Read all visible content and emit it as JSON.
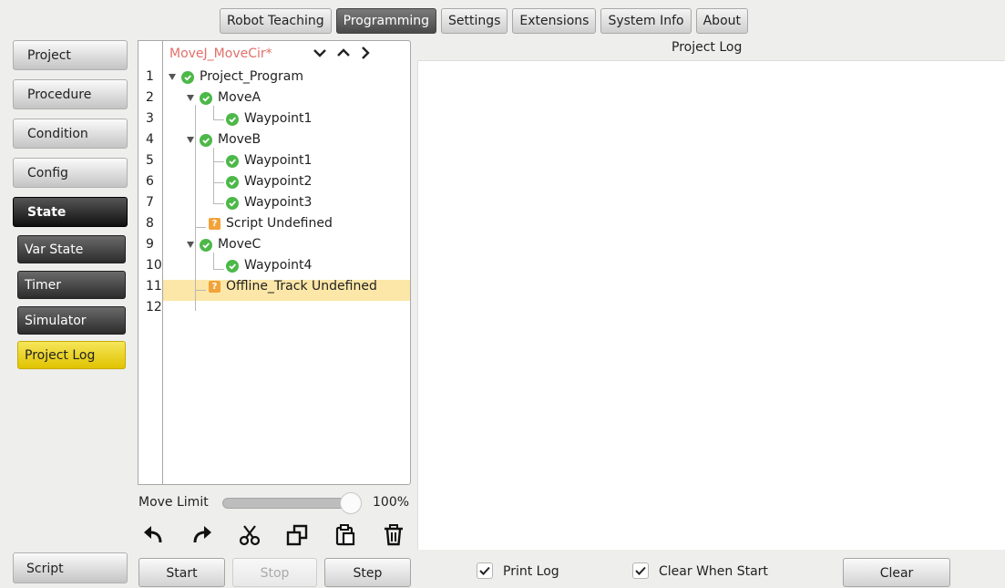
{
  "top_tabs": [
    "Robot Teaching",
    "Programming",
    "Settings",
    "Extensions",
    "System Info",
    "About"
  ],
  "active_tab": "Programming",
  "sidebar": {
    "items": [
      {
        "label": "Project"
      },
      {
        "label": "Procedure"
      },
      {
        "label": "Condition"
      },
      {
        "label": "Config"
      },
      {
        "label": "State"
      }
    ],
    "sub_items": [
      {
        "label": "Var State"
      },
      {
        "label": "Timer"
      },
      {
        "label": "Simulator"
      },
      {
        "label": "Project Log"
      }
    ],
    "script_label": "Script"
  },
  "program": {
    "name": "MoveJ_MoveCir*",
    "line_numbers": [
      "1",
      "2",
      "3",
      "4",
      "5",
      "6",
      "7",
      "8",
      "9",
      "10",
      "11",
      "12"
    ],
    "tree": [
      {
        "label": "Project_Program",
        "status": "ok"
      },
      {
        "label": "MoveA",
        "status": "ok"
      },
      {
        "label": "Waypoint1",
        "status": "ok"
      },
      {
        "label": "MoveB",
        "status": "ok"
      },
      {
        "label": "Waypoint1",
        "status": "ok"
      },
      {
        "label": "Waypoint2",
        "status": "ok"
      },
      {
        "label": "Waypoint3",
        "status": "ok"
      },
      {
        "label": "Script Undefined",
        "status": "undefined"
      },
      {
        "label": "MoveC",
        "status": "ok"
      },
      {
        "label": "Waypoint4",
        "status": "ok"
      },
      {
        "label": "Offline_Track Undefined",
        "status": "undefined"
      }
    ],
    "selected_line": "11"
  },
  "move_limit": {
    "label": "Move Limit",
    "value": 100,
    "value_text": "100%"
  },
  "toolbar_icons": [
    "undo-icon",
    "redo-icon",
    "cut-icon",
    "copy-icon",
    "paste-icon",
    "delete-icon"
  ],
  "controls": {
    "start": "Start",
    "stop": "Stop",
    "step": "Step"
  },
  "log": {
    "title": "Project Log",
    "print_log": {
      "label": "Print Log",
      "checked": true
    },
    "clear_when_start": {
      "label": "Clear When Start",
      "checked": true
    },
    "clear_label": "Clear"
  },
  "colors": {
    "accent_yellow": "#f0d400",
    "ok_green": "#4cb848",
    "warn_orange": "#f2a33a",
    "selected_row": "#fce7a8",
    "program_name": "#e0706a"
  }
}
